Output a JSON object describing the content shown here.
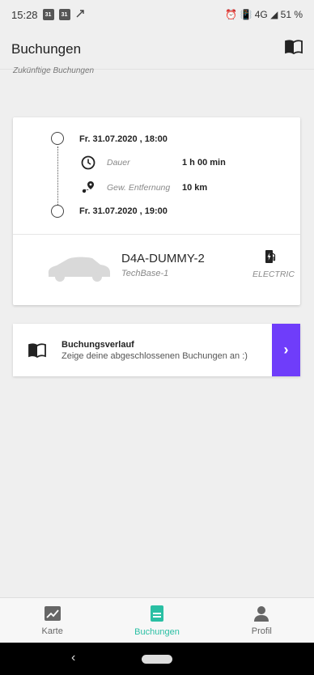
{
  "status_bar": {
    "time": "15:28",
    "cal1": "31",
    "cal2": "31",
    "right_text": "⏰ 📳 4G ◢ 51 %"
  },
  "app_bar": {
    "title": "Buchungen",
    "icon": "book-icon"
  },
  "section_label": "Zukünftige Buchungen",
  "booking": {
    "start": "Fr. 31.07.2020 , 18:00",
    "duration_label": "Dauer",
    "duration_value": "1 h 00 min",
    "distance_label": "Gew. Entfernung",
    "distance_value": "10 km",
    "end": "Fr. 31.07.2020 , 19:00",
    "car_name": "D4A-DUMMY-2",
    "car_location": "TechBase-1",
    "fuel_type": "ELECTRIC"
  },
  "history": {
    "title": "Buchungsverlauf",
    "subtitle": "Zeige deine abgeschlossenen Buchungen an :)",
    "button": "›"
  },
  "nav": {
    "items": [
      {
        "label": "Karte",
        "icon": "map-icon"
      },
      {
        "label": "Buchungen",
        "icon": "booking-doc-icon"
      },
      {
        "label": "Profil",
        "icon": "profile-icon"
      }
    ]
  },
  "colors": {
    "accent": "#6f3dfa",
    "active_tab": "#29bfa3",
    "background": "#efefef"
  }
}
